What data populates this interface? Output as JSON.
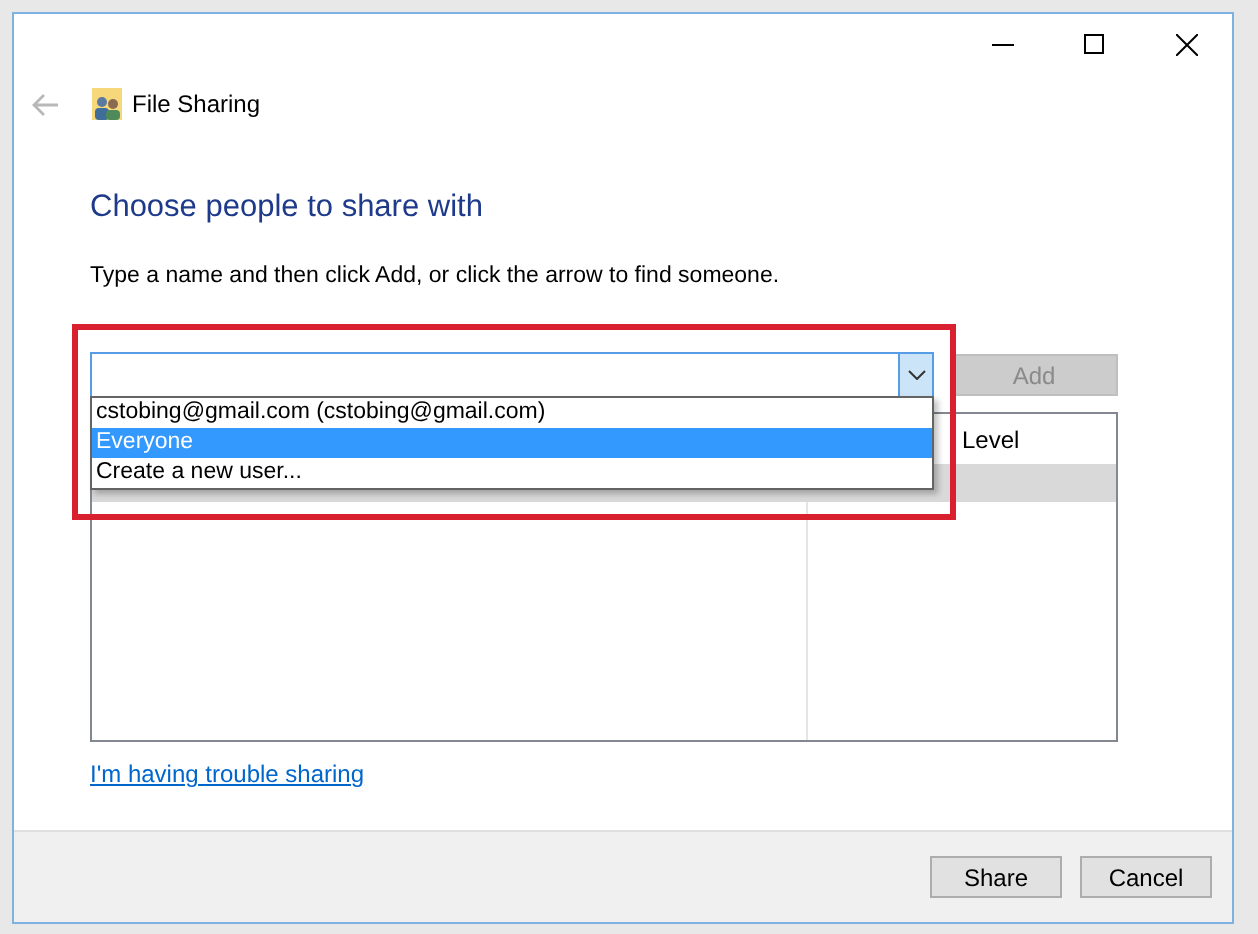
{
  "header": {
    "title": "File Sharing"
  },
  "heading": "Choose people to share with",
  "instruction": "Type a name and then click Add, or click the arrow to find someone.",
  "name_field": {
    "expanded": true
  },
  "add_button": {
    "label": "Add",
    "disabled": true
  },
  "dropdown": [
    {
      "label": "cstobing@gmail.com (cstobing@gmail.com)",
      "selected": false
    },
    {
      "label": "Everyone",
      "selected": true
    },
    {
      "label": "Create a new user...",
      "selected": false
    }
  ],
  "table": {
    "columns": [
      "",
      "Level"
    ],
    "rows": [
      {
        "selected": true
      }
    ]
  },
  "annotation": {
    "color": "#d9202f"
  },
  "help_link": "I'm having trouble sharing",
  "buttons": [
    {
      "label": "Share"
    },
    {
      "label": "Cancel"
    }
  ]
}
